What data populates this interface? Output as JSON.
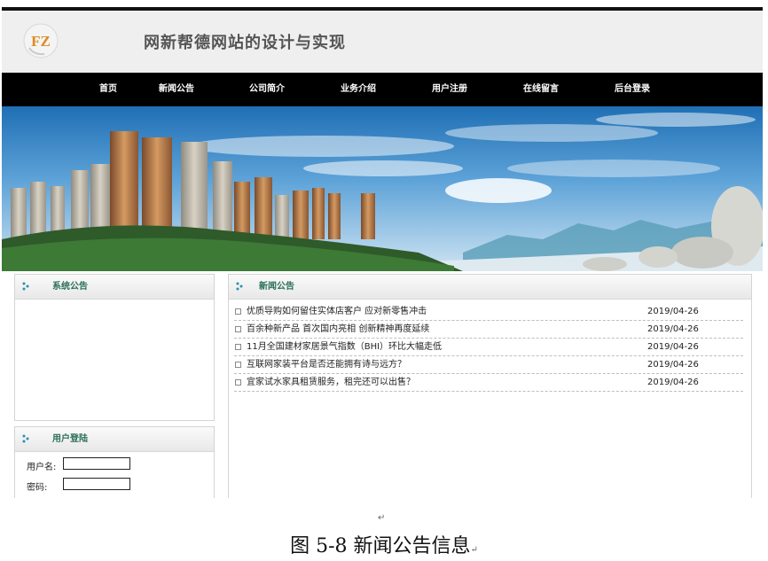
{
  "header": {
    "logo_text": "FZ",
    "site_title": "网新帮德网站的设计与实现"
  },
  "nav": {
    "items": [
      "首页",
      "新闻公告",
      "公司简介",
      "业务介绍",
      "用户注册",
      "在线留言",
      "后台登录"
    ]
  },
  "system_notice": {
    "title": "系统公告"
  },
  "user_login": {
    "title": "用户登陆",
    "username_label": "用户名:",
    "password_label": "密码:",
    "username_value": "",
    "password_value": ""
  },
  "news": {
    "title": "新闻公告",
    "items": [
      {
        "title": "优质导购如何留住实体店客户 应对新零售冲击",
        "date": "2019/04-26"
      },
      {
        "title": "百余种新产品 首次国内亮相 创新精神再度延续",
        "date": "2019/04-26"
      },
      {
        "title": "11月全国建材家居景气指数（BHI）环比大幅走低",
        "date": "2019/04-26"
      },
      {
        "title": "互联网家装平台是否还能拥有诗与远方？",
        "date": "2019/04-26"
      },
      {
        "title": "宜家试水家具租赁服务，租完还可以出售？",
        "date": "2019/04-26"
      }
    ]
  },
  "caption": {
    "text": "图 5-8 新闻公告信息",
    "return_mark": "↵"
  },
  "colors": {
    "nav_bg": "#000000",
    "panel_title": "#2a6f5a",
    "header_bg": "#efefef"
  }
}
